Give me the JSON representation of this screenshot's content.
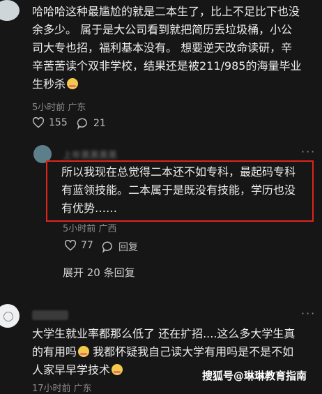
{
  "comment1": {
    "text_lines": [
      "哈哈哈这种最尴尬的就是二本生了，比上不足比下也没",
      "余多少。 属于是大公司看到就把简历丢垃圾桶，小公",
      "司大专也招，福利基本没有。 想要逆天改命读研，辛",
      "辛苦苦读个双非学校，结果还是被211/985的海量毕业",
      "生秒杀"
    ],
    "emoji": "crying-face",
    "meta": "5小时前 广东",
    "likes": "155",
    "replies": "21"
  },
  "reply1": {
    "username": "上年黑黑黑黑",
    "text_lines": [
      "所以我现在总觉得二本还不如专科，最起码专科",
      "有蓝领技能。二本属于是既没有技能，学历也没",
      "有优势……"
    ],
    "meta": "5小时前 广西",
    "likes": "77",
    "reply_label": "回复",
    "highlight_color": "#e0241c"
  },
  "expand_label": "展开 20 条回复",
  "comment2": {
    "text_lines": [
      "大学生就业率都那么低了 还在扩招....这么多大学生真",
      "的有用吗",
      " 我都怀疑我自己读大学有用吗是不是不如",
      "人家早早学技术"
    ],
    "meta_partial": "17小时前 广东"
  },
  "watermark": "搜狐号@琳琳教育指南",
  "more_label": "···"
}
